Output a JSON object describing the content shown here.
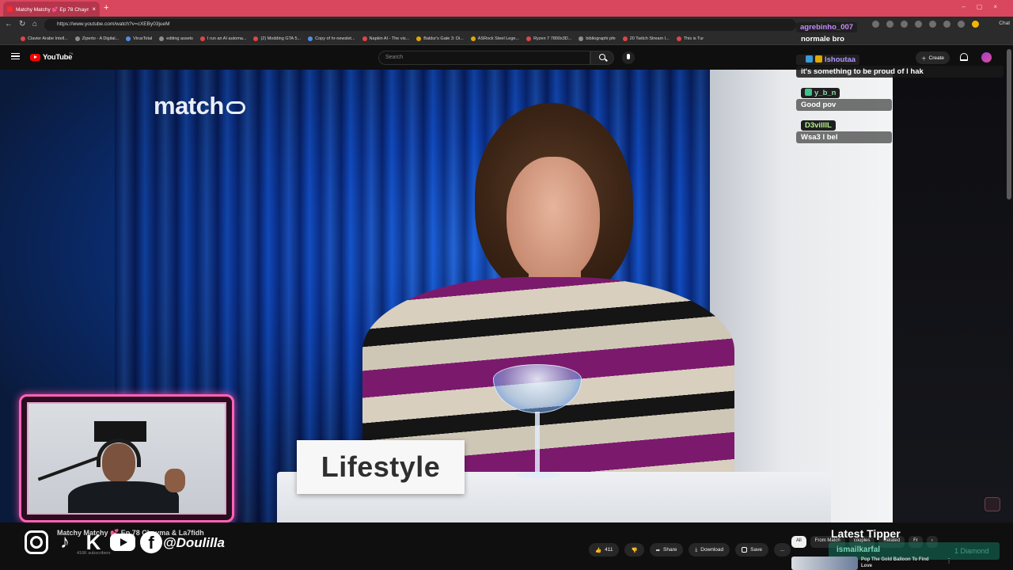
{
  "browser": {
    "tab_title": "Matchy Matchy 💕 Ep 78 Chayma",
    "new_tab": "+",
    "url": "https://www.youtube.com/watch?v=cXEBy03jueM",
    "chat_button": "Chat",
    "bookmarks": [
      "Clavier Arabe Intell...",
      "Ziperto - A Digital...",
      "VirusTotal",
      "editing assets",
      "I run an AI automa...",
      "(2) Modding GTA 5...",
      "Copy of hr-newslet...",
      "Napkin AI - The vis...",
      "Baldur's Gate 3: Di...",
      "ASRock Steel Lege...",
      "Ryzen 7 7800x3D...",
      "bibliographi pfe",
      "20 Twitch Stream I...",
      "This is Tur"
    ]
  },
  "youtube": {
    "logo_text": "YouTube",
    "logo_tm": "TN",
    "search_placeholder": "Search",
    "create_label": "Create"
  },
  "video": {
    "show_logo": "match",
    "card_text": "Lifestyle",
    "title": "Matchy Matchy 💕 Ep 78 Chayma & La7fidh",
    "subscribers": "416K subscribers",
    "actions": {
      "likes": "411",
      "share": "Share",
      "download": "Download",
      "save": "Save",
      "more": "..."
    }
  },
  "overlay": {
    "handle": "@Doulilla",
    "social_icons": [
      "instagram-icon",
      "tiktok-icon",
      "kick-icon",
      "youtube-icon",
      "facebook-icon"
    ],
    "latest_tipper_label": "Latest Tipper",
    "tipper_name": "ismailkarfal",
    "tipper_amount": "1 Diamond"
  },
  "chat": [
    {
      "user": "agrebinho_007",
      "text": "normale bro",
      "user_color": "#c78bff"
    },
    {
      "user": "Ishoutaa",
      "text": "it's something to be proud of l hak",
      "user_color": "#b197ff"
    },
    {
      "user": "y_b_n",
      "text": "Good pov",
      "user_color": "#8fd9a8"
    },
    {
      "user": "D3villlL",
      "text": "Wsa3 l bel",
      "user_color": "#b6f58c"
    }
  ],
  "sidebar": {
    "chips": [
      "All",
      "From Match",
      "couples",
      "Related",
      "Fr"
    ],
    "next_chevron": "›",
    "rec_title": "Pop The Gold Balloon To Find Love"
  },
  "colors": {
    "tab_strip": "#d9475e",
    "webcam_border": "#ff63b8",
    "yt_red": "#ff0000"
  }
}
